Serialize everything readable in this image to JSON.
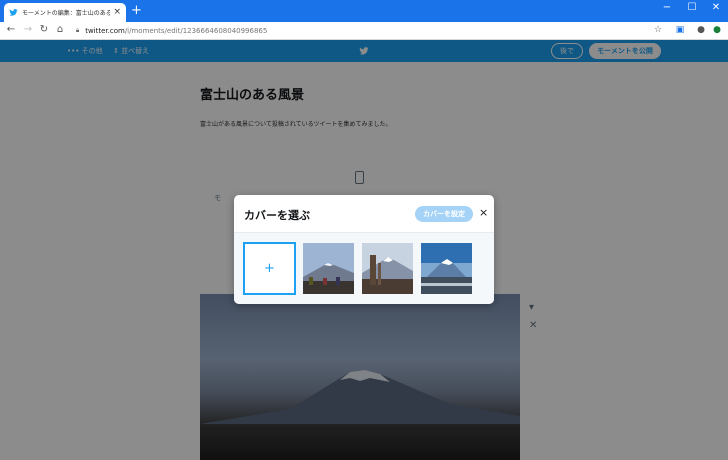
{
  "browser": {
    "tab_title": "モーメントの編集：富士山のある風景",
    "tab_close": "×",
    "new_tab": "+",
    "url_host": "twitter.com",
    "url_path": "/i/moments/edit/1236664608040996865",
    "window_controls": [
      "−",
      "☐",
      "✕"
    ]
  },
  "twitter": {
    "nav_more": "••• その他",
    "nav_sort": "⇕ 並べ替え",
    "later_label": "後で",
    "publish_label": "モーメントを公開"
  },
  "moment": {
    "title": "富士山のある風景",
    "description": "富士山がある風景について投稿されているツイートを集めてみました。",
    "hint": "モ"
  },
  "dialog": {
    "title": "カバーを選ぶ",
    "set_cover_label": "カバーを設定",
    "close": "×",
    "add_label": "+"
  },
  "colors": {
    "chrome_blue": "#1a73e8",
    "twitter_blue": "#1da1f2",
    "button_disabled": "#a5d3f7"
  }
}
